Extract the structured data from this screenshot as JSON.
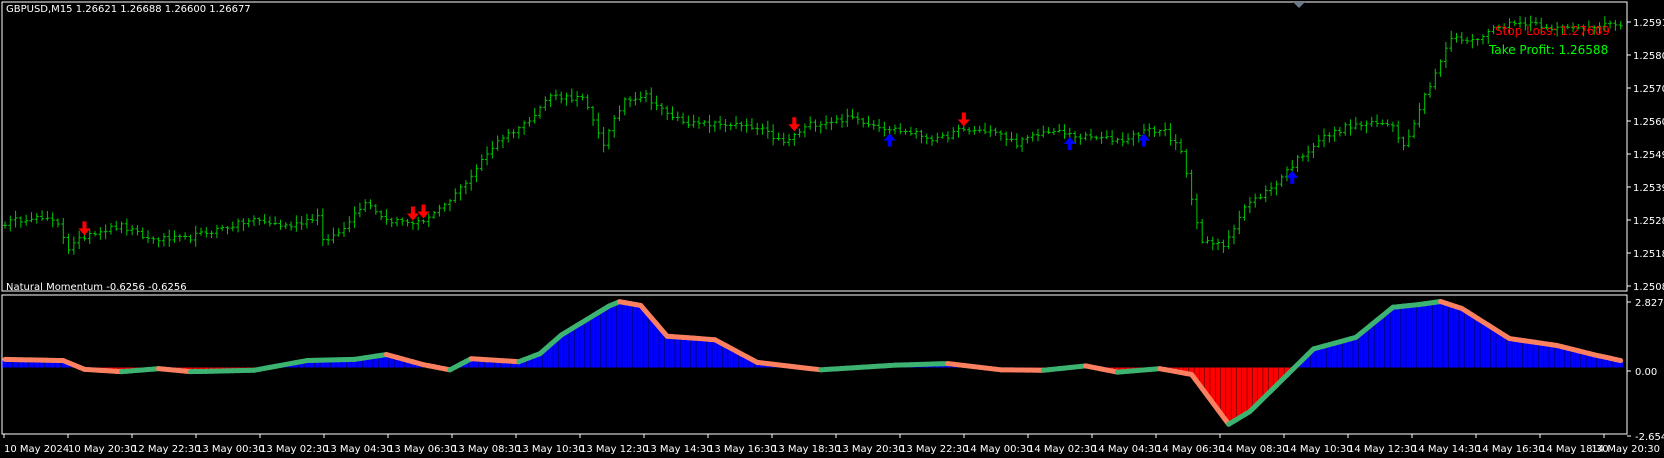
{
  "main_header": "GBPUSD,M15  1.26621 1.26688 1.26600 1.26677",
  "sub_header": "Natural Momentum -0.6256 -0.6256",
  "stop_loss": {
    "text": "Stop Loss: 1.27609",
    "color": "#ff0000"
  },
  "take_profit": {
    "text": "Take Profit: 1.26588",
    "color": "#00ff00"
  },
  "colors": {
    "bar": "#00c800",
    "up_arrow": "#0000ff",
    "down_arrow": "#ff0000",
    "hist_pos": "#0000ff",
    "hist_neg": "#ff0000",
    "line_green": "#3cb371",
    "line_orange": "#fa8060",
    "grid": "#ffffff"
  },
  "chart_data": [
    {
      "type": "bar",
      "symbol": "GBPUSD",
      "timeframe": "M15",
      "y_ticks": [
        "1.25910",
        "1.25805",
        "1.25700",
        "1.25600",
        "1.25495",
        "1.25390",
        "1.25285",
        "1.25185",
        "1.25080"
      ],
      "ylim": [
        1.2506,
        1.2596
      ],
      "x_tick_labels": [
        "10 May 2024",
        "10 May 20:30",
        "12 May 22:30",
        "13 May 00:30",
        "13 May 02:30",
        "13 May 04:30",
        "13 May 06:30",
        "13 May 08:30",
        "13 May 10:30",
        "13 May 12:30",
        "13 May 14:30",
        "13 May 16:30",
        "13 May 18:30",
        "13 May 20:30",
        "13 May 22:30",
        "14 May 00:30",
        "14 May 02:30",
        "14 May 04:30",
        "14 May 06:30",
        "14 May 08:30",
        "14 May 10:30",
        "14 May 12:30",
        "14 May 14:30",
        "14 May 16:30",
        "14 May 18:30",
        "14 May 20:30"
      ],
      "close_path": [
        [
          0,
          1.2527
        ],
        [
          5,
          1.2529
        ],
        [
          10,
          1.2527
        ],
        [
          12,
          1.2519
        ],
        [
          16,
          1.2524
        ],
        [
          22,
          1.2526
        ],
        [
          27,
          1.2522
        ],
        [
          34,
          1.2522
        ],
        [
          40,
          1.2525
        ],
        [
          47,
          1.2528
        ],
        [
          53,
          1.2526
        ],
        [
          59,
          1.2529
        ],
        [
          60,
          1.2521
        ],
        [
          63,
          1.2524
        ],
        [
          68,
          1.2534
        ],
        [
          72,
          1.2528
        ],
        [
          78,
          1.2527
        ],
        [
          83,
          1.2532
        ],
        [
          88,
          1.2542
        ],
        [
          93,
          1.2553
        ],
        [
          98,
          1.2558
        ],
        [
          103,
          1.2567
        ],
        [
          109,
          1.2566
        ],
        [
          113,
          1.2552
        ],
        [
          117,
          1.2566
        ],
        [
          121,
          1.2567
        ],
        [
          125,
          1.2561
        ],
        [
          130,
          1.2558
        ],
        [
          137,
          1.2558
        ],
        [
          143,
          1.2556
        ],
        [
          147,
          1.2552
        ],
        [
          152,
          1.2558
        ],
        [
          160,
          1.256
        ],
        [
          166,
          1.2557
        ],
        [
          172,
          1.2555
        ],
        [
          176,
          1.2553
        ],
        [
          180,
          1.2556
        ],
        [
          186,
          1.2556
        ],
        [
          191,
          1.2552
        ],
        [
          197,
          1.2556
        ],
        [
          203,
          1.2554
        ],
        [
          211,
          1.2553
        ],
        [
          215,
          1.2556
        ],
        [
          219,
          1.2556
        ],
        [
          222,
          1.2549
        ],
        [
          226,
          1.2521
        ],
        [
          230,
          1.252
        ],
        [
          234,
          1.2532
        ],
        [
          239,
          1.2538
        ],
        [
          244,
          1.2547
        ],
        [
          248,
          1.2553
        ],
        [
          253,
          1.2557
        ],
        [
          257,
          1.2558
        ],
        [
          262,
          1.2558
        ],
        [
          264,
          1.2551
        ],
        [
          268,
          1.2567
        ],
        [
          273,
          1.2585
        ],
        [
          277,
          1.2584
        ],
        [
          282,
          1.2589
        ],
        [
          288,
          1.259
        ],
        [
          293,
          1.2588
        ],
        [
          298,
          1.2588
        ],
        [
          302,
          1.259
        ],
        [
          305,
          1.2588
        ]
      ],
      "buy_signal_bars": [
        167,
        201,
        215,
        243
      ],
      "sell_signal_bars": [
        15,
        77,
        79,
        149,
        181
      ],
      "stop_loss_label": "Stop Loss: 1.27609",
      "take_profit_label": "Take Profit: 1.26588"
    },
    {
      "type": "line",
      "name": "Natural Momentum",
      "ylim": [
        -2.6549,
        2.8278
      ],
      "y_ticks": [
        "2.8278",
        "0.00",
        "-2.6549"
      ],
      "path": [
        [
          0,
          0.35
        ],
        [
          11,
          0.3
        ],
        [
          15,
          -0.08
        ],
        [
          22,
          -0.18
        ],
        [
          29,
          -0.05
        ],
        [
          35,
          -0.18
        ],
        [
          47,
          -0.12
        ],
        [
          57,
          0.3
        ],
        [
          66,
          0.35
        ],
        [
          72,
          0.56
        ],
        [
          79,
          0.12
        ],
        [
          84,
          -0.1
        ],
        [
          88,
          0.38
        ],
        [
          97,
          0.25
        ],
        [
          101,
          0.6
        ],
        [
          105,
          1.4
        ],
        [
          114,
          2.65
        ],
        [
          116,
          2.84
        ],
        [
          120,
          2.68
        ],
        [
          125,
          1.35
        ],
        [
          134,
          1.2
        ],
        [
          142,
          0.22
        ],
        [
          154,
          -0.1
        ],
        [
          168,
          0.1
        ],
        [
          178,
          0.17
        ],
        [
          188,
          -0.1
        ],
        [
          196,
          -0.12
        ],
        [
          204,
          0.07
        ],
        [
          210,
          -0.2
        ],
        [
          218,
          -0.05
        ],
        [
          224,
          -0.3
        ],
        [
          231,
          -2.45
        ],
        [
          235,
          -1.9
        ],
        [
          239,
          -1.0
        ],
        [
          247,
          0.8
        ],
        [
          255,
          1.3
        ],
        [
          262,
          2.6
        ],
        [
          267,
          2.72
        ],
        [
          271,
          2.85
        ],
        [
          275,
          2.55
        ],
        [
          284,
          1.25
        ],
        [
          293,
          0.95
        ],
        [
          300,
          0.55
        ],
        [
          305,
          0.3
        ]
      ]
    }
  ]
}
